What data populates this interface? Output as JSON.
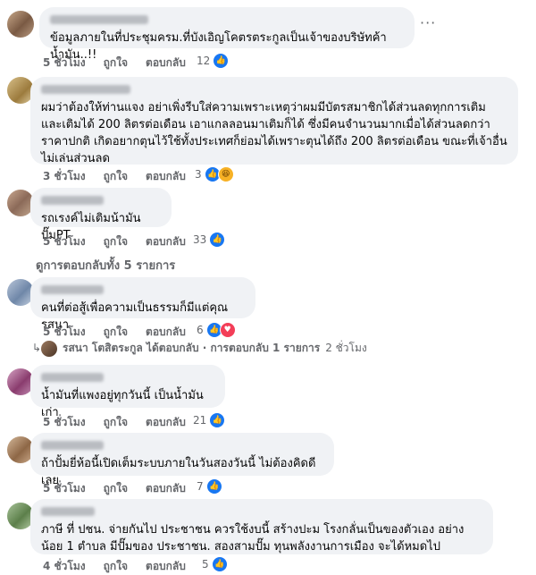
{
  "comments": [
    {
      "text": "ข้อมูลภายในที่ประชุมครม.ที่บังเอิญโคตรตระกูลเป็นเจ้าของบริษัทค้าน้ำมัน..!!",
      "time": "5 ชั่วโมง",
      "like": "ถูกใจ",
      "reply": "ตอบกลับ",
      "count": "12"
    },
    {
      "text": "ผมว่าต้องให้ท่านแจง อย่าเพิ่งรีบใส่ความเพราะเหตุว่าผมมีบัตรสมาชิกได้ส่วนลดทุกการเติม และเติมได้ 200 ลิตรต่อเดือน เอาแกลลอนมาเติมก็ได้ ซึ่งมีคนจำนวนมากเมื่อได้ส่วนลดกว่าราคาปกติ เกิดอยากตุนไว้ใช้ทั้งประเทศก็ย่อมได้เพราะตุนได้ถึง 200 ลิตรต่อเดือน ขณะที่เจ้าอื่นไม่เล่นส่วนลด",
      "time": "3 ชั่วโมง",
      "like": "ถูกใจ",
      "reply": "ตอบกลับ",
      "count": "3"
    },
    {
      "text": "รถเรงค์ไม่เติมน้ามันปั๊มPT",
      "time": "5 ชั่วโมง",
      "like": "ถูกใจ",
      "reply": "ตอบกลับ",
      "count": "33"
    },
    {
      "text": "คนที่ต่อสู้เพื่อความเป็นธรรมก็มีแต่คุณรสนา",
      "time": "5 ชั่วโมง",
      "like": "ถูกใจ",
      "reply": "ตอบกลับ",
      "count": "6"
    },
    {
      "text": "น้ำมันที่แพงอยู่ทุกวันนี้ เป็นน้ำมันเก่า",
      "time": "5 ชั่วโมง",
      "like": "ถูกใจ",
      "reply": "ตอบกลับ",
      "count": "21"
    },
    {
      "text": "ถ้าปั้มยี่ห้อนี้เปิดเต็มระบบภายในวันสองวันนี้ ไม่ต้องคิดดีเลย",
      "time": "5 ชั่วโมง",
      "like": "ถูกใจ",
      "reply": "ตอบกลับ",
      "count": "7"
    },
    {
      "text": "ภาษี ที่ ปชน. จ่ายกันไป ประชาชน ควรใช้งบนี้ สร้างปะม โรงกลั่นเป็นของตัวเอง อย่างน้อย 1 ตำบล มีปั๊มของ ประชาชน. สองสามปั๊ม ทุนพลังงานการเมือง จะได้หมดไป",
      "time": "4 ชั่วโมง",
      "like": "ถูกใจ",
      "reply": "ตอบกลับ",
      "count": "5"
    }
  ],
  "view_all_replies": "ดูการตอบกลับทั้ง 5 รายการ",
  "reply_summary": {
    "text": "รสนา โตสิตระกูล ได้ตอบกลับ · การตอบกลับ 1 รายการ",
    "time": "2 ชั่วโมง"
  },
  "icons": {
    "more": "more-dots-icon",
    "like": "like-icon",
    "haha": "haha-icon",
    "love": "love-icon"
  },
  "colors": {
    "like_blue": "#1877f2",
    "bubble": "#f0f2f5",
    "meta_gray": "#65676b"
  }
}
